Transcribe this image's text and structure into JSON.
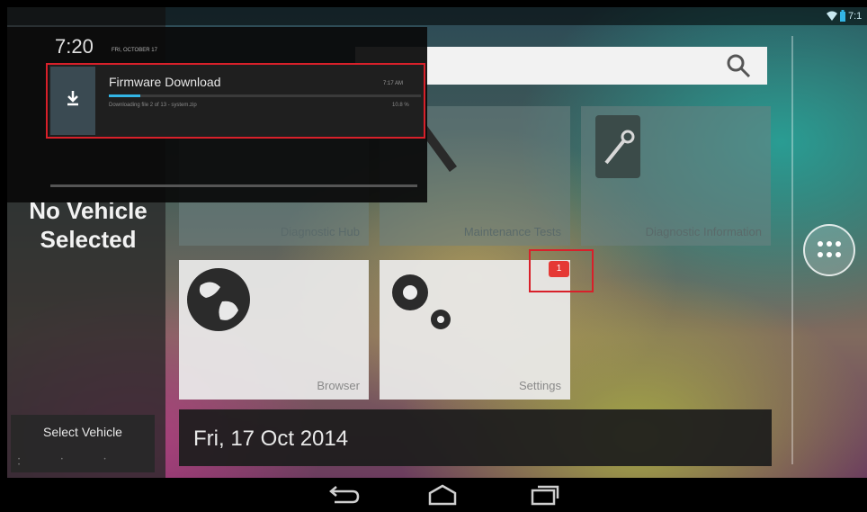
{
  "status_bar": {
    "time": "7:1",
    "wifi_icon": "wifi-icon",
    "battery_icon": "battery-icon"
  },
  "notification": {
    "time": "7:20",
    "date": "FRI, OCTOBER 17",
    "title": "Firmware Download",
    "posted_time": "7:17 AM",
    "subtitle": "Downloading file 2 of 13 - system.zip",
    "percent": "10.8 %",
    "progress_fraction": 0.1,
    "icon": "download-icon"
  },
  "left_panel": {
    "vehicle_status": [
      "No Vehicle",
      "Selected"
    ],
    "select_vehicle_label": "Select Vehicle"
  },
  "tiles": [
    {
      "label": "Diagnostic Hub"
    },
    {
      "label": "Maintenance Tests"
    },
    {
      "label": "Diagnostic Information"
    },
    {
      "label": "Browser"
    },
    {
      "label": "Settings"
    }
  ],
  "badge": {
    "count": "1",
    "color": "#e53935"
  },
  "date_bar": {
    "text": "Fri, 17 Oct 2014"
  },
  "search": {
    "icon": "search-icon"
  },
  "highlight_color": "#d8202a",
  "accent_color": "#33b5e5"
}
